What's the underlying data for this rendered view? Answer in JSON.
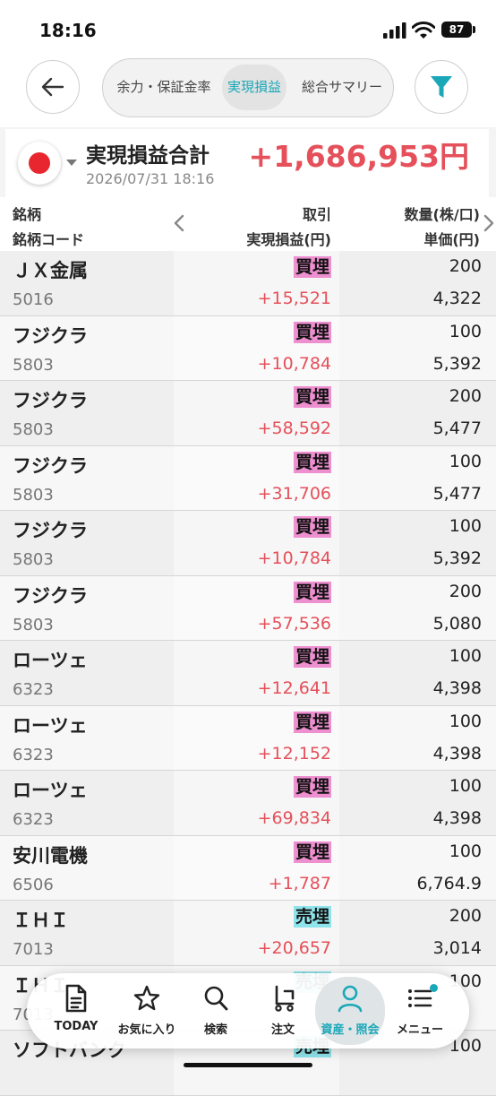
{
  "status_bar": {
    "time": "18:16",
    "battery": "87"
  },
  "header": {
    "tabs": [
      {
        "label": "余力・保証金率",
        "active": false
      },
      {
        "label": "実現損益",
        "active": true
      },
      {
        "label": "総合サマリー",
        "active": false
      }
    ]
  },
  "summary": {
    "label": "実現損益合計",
    "date": "2026/07/31 18:16",
    "value": "+1,686,953円"
  },
  "table_header": {
    "col1_line1": "銘柄",
    "col1_line2": "銘柄コード",
    "col2_line1": "取引",
    "col2_line2": "実現損益(円)",
    "col3_line1": "数量(株/口)",
    "col3_line2": "単価(円)"
  },
  "rows": [
    {
      "name": "ＪＸ金属",
      "code": "5016",
      "trade": "買埋",
      "pnl": "+15,521",
      "qty": "200",
      "price": "4,322"
    },
    {
      "name": "フジクラ",
      "code": "5803",
      "trade": "買埋",
      "pnl": "+10,784",
      "qty": "100",
      "price": "5,392"
    },
    {
      "name": "フジクラ",
      "code": "5803",
      "trade": "買埋",
      "pnl": "+58,592",
      "qty": "200",
      "price": "5,477"
    },
    {
      "name": "フジクラ",
      "code": "5803",
      "trade": "買埋",
      "pnl": "+31,706",
      "qty": "100",
      "price": "5,477"
    },
    {
      "name": "フジクラ",
      "code": "5803",
      "trade": "買埋",
      "pnl": "+10,784",
      "qty": "100",
      "price": "5,392"
    },
    {
      "name": "フジクラ",
      "code": "5803",
      "trade": "買埋",
      "pnl": "+57,536",
      "qty": "200",
      "price": "5,080"
    },
    {
      "name": "ローツェ",
      "code": "6323",
      "trade": "買埋",
      "pnl": "+12,641",
      "qty": "100",
      "price": "4,398"
    },
    {
      "name": "ローツェ",
      "code": "6323",
      "trade": "買埋",
      "pnl": "+12,152",
      "qty": "100",
      "price": "4,398"
    },
    {
      "name": "ローツェ",
      "code": "6323",
      "trade": "買埋",
      "pnl": "+69,834",
      "qty": "100",
      "price": "4,398"
    },
    {
      "name": "安川電機",
      "code": "6506",
      "trade": "買埋",
      "pnl": "+1,787",
      "qty": "100",
      "price": "6,764.9"
    },
    {
      "name": "ＩＨＩ",
      "code": "7013",
      "trade": "売埋",
      "pnl": "+20,657",
      "qty": "200",
      "price": "3,014"
    },
    {
      "name": "ＩＨＩ",
      "code": "7013",
      "trade": "売埋",
      "pnl": "",
      "qty": "100",
      "price": ""
    },
    {
      "name": "ソフトバンク",
      "code": "",
      "trade": "売埋",
      "pnl": "",
      "qty": "100",
      "price": ""
    }
  ],
  "bottom_nav": [
    {
      "label": "TODAY",
      "icon": "document-icon"
    },
    {
      "label": "お気に入り",
      "icon": "star-icon"
    },
    {
      "label": "検索",
      "icon": "search-icon"
    },
    {
      "label": "注文",
      "icon": "cart-icon"
    },
    {
      "label": "資産・照会",
      "icon": "person-icon",
      "active": true
    },
    {
      "label": "メニュー",
      "icon": "menu-icon"
    }
  ],
  "colors": {
    "accent": "#1aa8b8",
    "profit": "#e5505a",
    "buy_badge": "#ee8fd0",
    "sell_badge": "#8fe3ea"
  }
}
